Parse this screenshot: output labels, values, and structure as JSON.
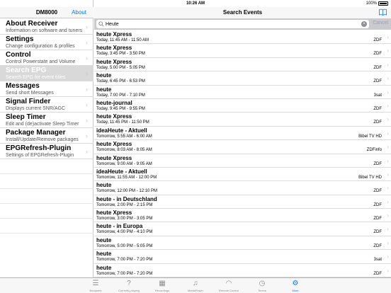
{
  "status_bar": {
    "carrier": "iPad",
    "time": "10:26 AM",
    "battery_percent": "100%"
  },
  "left_nav": {
    "title": "DM8000",
    "about_label": "About"
  },
  "menu": [
    {
      "title": "About Receiver",
      "subtitle": "Information on software and tuners",
      "selected": false
    },
    {
      "title": "Settings",
      "subtitle": "Change configuration & profiles",
      "selected": false
    },
    {
      "title": "Control",
      "subtitle": "Control Powerstate and Volume",
      "selected": false
    },
    {
      "title": "Search EPG",
      "subtitle": "Search EPG for event titles",
      "selected": true
    },
    {
      "title": "Messages",
      "subtitle": "Send short Messages",
      "selected": false
    },
    {
      "title": "Signal Finder",
      "subtitle": "Displays current SNR/AGC",
      "selected": false
    },
    {
      "title": "Sleep Timer",
      "subtitle": "Edit and (de)activate Sleep Timer",
      "selected": false
    },
    {
      "title": "Package Manager",
      "subtitle": "Install/Update/Remove packages",
      "selected": false
    },
    {
      "title": "EPGRefresh-Plugin",
      "subtitle": "Settings of EPGRefresh-Plugin",
      "selected": false
    }
  ],
  "right_nav": {
    "title": "Search Events",
    "book_icon": "book-icon"
  },
  "search": {
    "value": "Heute",
    "cancel_label": "Cancel"
  },
  "events": [
    {
      "name": "heute Xpress",
      "time": "Today, 11:45 AM - 11:50 AM",
      "channel": "ZDF"
    },
    {
      "name": "heute Xpress",
      "time": "Today, 3:45 PM - 3:50 PM",
      "channel": "ZDF"
    },
    {
      "name": "heute Xpress",
      "time": "Today, 5:00 PM - 5:05 PM",
      "channel": "ZDF"
    },
    {
      "name": "heute",
      "time": "Today, 6:45 PM - 6:53 PM",
      "channel": "ZDF"
    },
    {
      "name": "heute",
      "time": "Today, 7:00 PM - 7:10 PM",
      "channel": "3sat"
    },
    {
      "name": "heute-journal",
      "time": "Today, 9:45 PM - 9:55 PM",
      "channel": "ZDF"
    },
    {
      "name": "heute Xpress",
      "time": "Today, 11:45 PM - 11:50 PM",
      "channel": "ZDF"
    },
    {
      "name": "ideaHeute - Aktuell",
      "time": "Tomorrow, 5:55 AM - 6:00 AM",
      "channel": "Bibel TV HD"
    },
    {
      "name": "heute Xpress",
      "time": "Tomorrow, 8:03 AM - 8:05 AM",
      "channel": "ZDFinfo"
    },
    {
      "name": "heute Xpress",
      "time": "Tomorrow, 9:00 AM - 9:05 AM",
      "channel": "ZDF"
    },
    {
      "name": "ideaHeute - Aktuell",
      "time": "Tomorrow, 11:55 AM - 12:00 PM",
      "channel": "Bibel TV HD"
    },
    {
      "name": "heute",
      "time": "Tomorrow, 12:00 PM - 12:10 PM",
      "channel": "ZDF"
    },
    {
      "name": "heute - in Deutschland",
      "time": "Tomorrow, 2:00 PM - 2:15 PM",
      "channel": "ZDF"
    },
    {
      "name": "heute Xpress",
      "time": "Tomorrow, 3:00 PM - 3:05 PM",
      "channel": "ZDF"
    },
    {
      "name": "heute - in Europa",
      "time": "Tomorrow, 4:00 PM - 4:10 PM",
      "channel": "ZDF"
    },
    {
      "name": "heute",
      "time": "Tomorrow, 5:00 PM - 5:05 PM",
      "channel": "ZDF"
    },
    {
      "name": "heute",
      "time": "Tomorrow, 7:00 PM - 7:20 PM",
      "channel": "3sat"
    },
    {
      "name": "heute",
      "time": "Tomorrow, 7:00 PM - 7:20 PM",
      "channel": "ZDF"
    }
  ],
  "tabs": [
    {
      "label": "Bouquets",
      "icon": "list-icon",
      "active": false
    },
    {
      "label": "Currently playing",
      "icon": "question-icon",
      "active": false
    },
    {
      "label": "Recordings",
      "icon": "film-icon",
      "active": false
    },
    {
      "label": "MediaPlayer",
      "icon": "music-note-icon",
      "active": false
    },
    {
      "label": "Remote Control",
      "icon": "wifi-icon",
      "active": false
    },
    {
      "label": "Timers",
      "icon": "clock-icon",
      "active": false
    },
    {
      "label": "More",
      "icon": "gears-icon",
      "active": true
    }
  ],
  "colors": {
    "accent": "#007aff",
    "selected_row": "#d9d9d9",
    "inactive_tab": "#8e8e93"
  }
}
